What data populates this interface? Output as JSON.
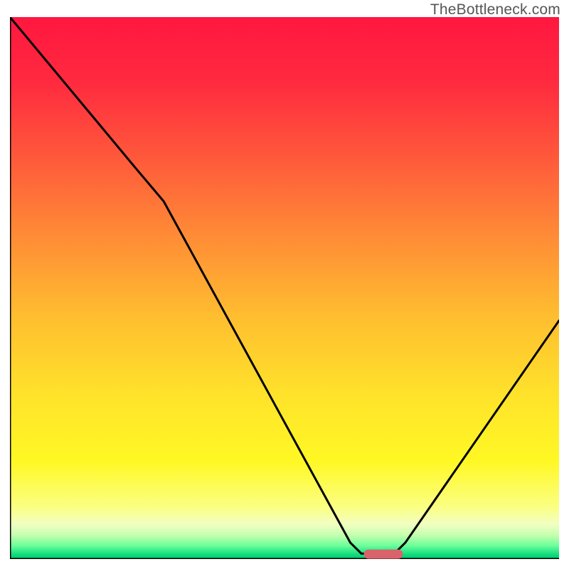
{
  "watermark": {
    "text": "TheBottleneck.com"
  },
  "colors": {
    "gradient_stops": [
      {
        "offset": 0.0,
        "color": "#ff173f"
      },
      {
        "offset": 0.12,
        "color": "#ff2a3f"
      },
      {
        "offset": 0.26,
        "color": "#ff593b"
      },
      {
        "offset": 0.4,
        "color": "#ff8a36"
      },
      {
        "offset": 0.55,
        "color": "#ffbd30"
      },
      {
        "offset": 0.7,
        "color": "#ffe32a"
      },
      {
        "offset": 0.82,
        "color": "#fff824"
      },
      {
        "offset": 0.905,
        "color": "#fbff84"
      },
      {
        "offset": 0.935,
        "color": "#f2ffc2"
      },
      {
        "offset": 0.955,
        "color": "#c8ffb0"
      },
      {
        "offset": 0.975,
        "color": "#6dff9a"
      },
      {
        "offset": 0.99,
        "color": "#18e080"
      },
      {
        "offset": 1.0,
        "color": "#02c46a"
      }
    ],
    "curve_stroke": "#000000",
    "axis_stroke": "#000000",
    "marker_fill": "#d9636b",
    "marker_stroke": "#d9636b"
  },
  "chart_data": {
    "type": "line",
    "title": "",
    "xlabel": "",
    "ylabel": "",
    "xlim": [
      0,
      100
    ],
    "ylim": [
      0,
      100
    ],
    "curve": [
      {
        "x": 0,
        "y": 100
      },
      {
        "x": 23,
        "y": 72
      },
      {
        "x": 28,
        "y": 66
      },
      {
        "x": 62,
        "y": 3
      },
      {
        "x": 64,
        "y": 1
      },
      {
        "x": 70,
        "y": 1
      },
      {
        "x": 72,
        "y": 3
      },
      {
        "x": 100,
        "y": 44
      }
    ],
    "marker": {
      "x_start": 64.5,
      "x_end": 71.5,
      "y": 0.9
    }
  }
}
